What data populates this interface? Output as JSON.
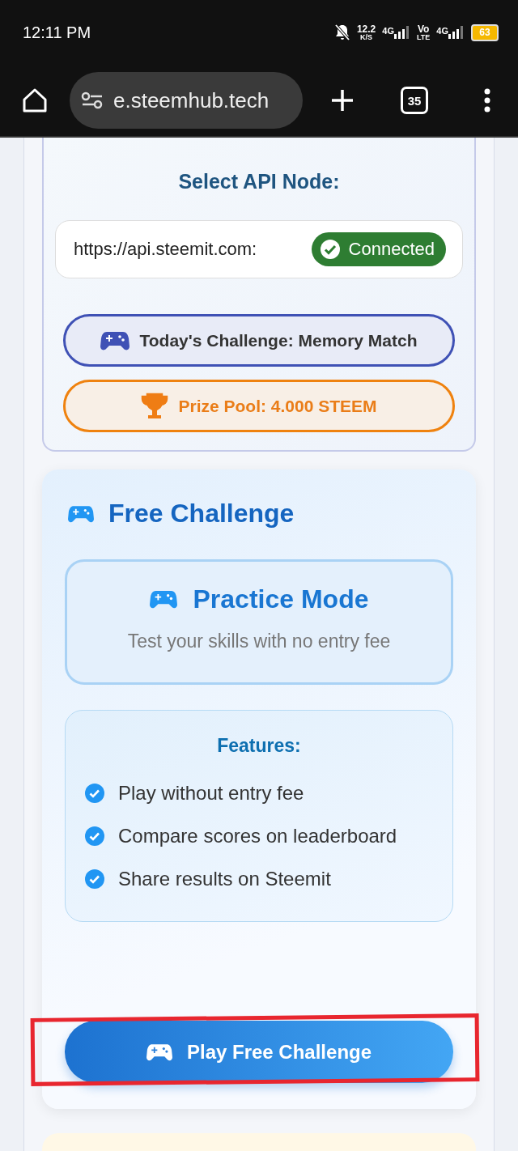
{
  "status_bar": {
    "time": "12:11 PM",
    "speed_value": "12.2",
    "speed_unit": "K/S",
    "sim1_network": "4G",
    "volte_top": "Vo",
    "volte_bottom": "LTE",
    "sim2_network": "4G",
    "battery": "63"
  },
  "browser_bar": {
    "url": "e.steemhub.tech",
    "tab_count": "35"
  },
  "api_card": {
    "title": "Select API Node:",
    "node_url": "https://api.steemit.com:",
    "status": "Connected",
    "connected": true,
    "pills": [
      {
        "kind": "challenge",
        "text": "Today's Challenge: Memory Match"
      },
      {
        "kind": "prize",
        "text": "Prize Pool: 4.000 STEEM"
      }
    ]
  },
  "free_card": {
    "title": "Free Challenge",
    "mode_title": "Practice Mode",
    "mode_subtitle": "Test your skills with no entry fee",
    "features_title": "Features:",
    "features": [
      "Play without entry fee",
      "Compare scores on leaderboard",
      "Share results on Steemit"
    ],
    "button": "Play Free Challenge"
  },
  "annotation": {
    "kind": "rectangle"
  }
}
